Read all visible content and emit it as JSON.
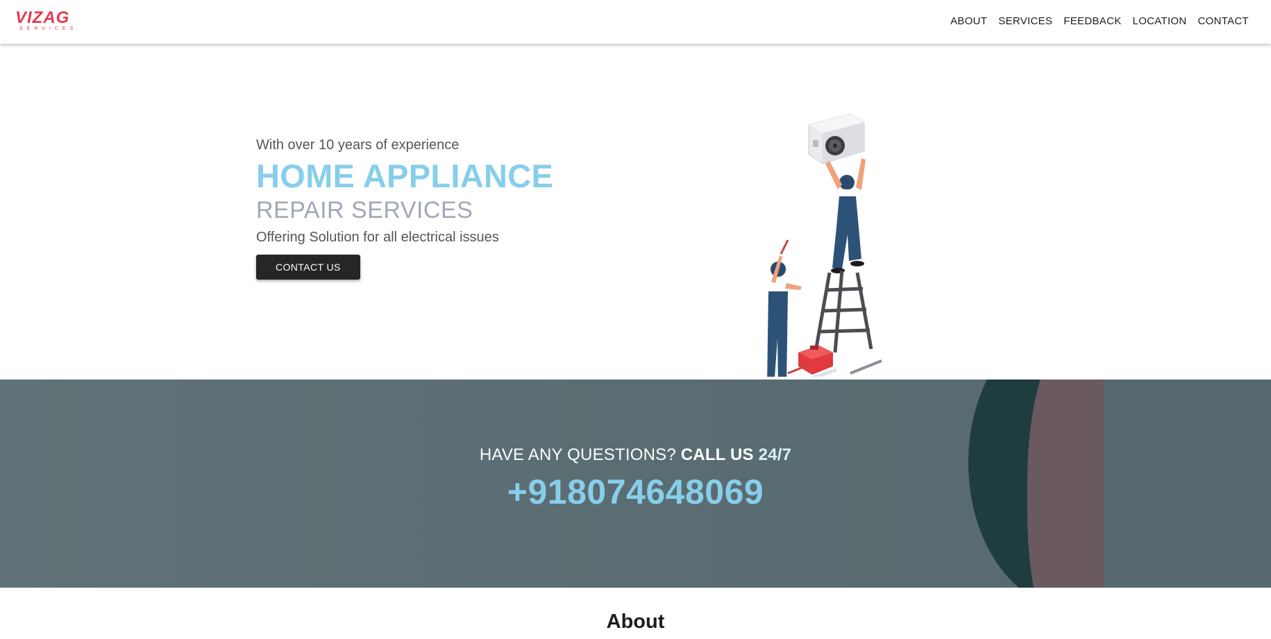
{
  "brand": {
    "logo_text": "VIZAG",
    "logo_sub": "SERVICES",
    "color": "#e03c4f"
  },
  "nav": {
    "items": [
      {
        "label": "ABOUT"
      },
      {
        "label": "SERVICES"
      },
      {
        "label": "FEEDBACK"
      },
      {
        "label": "LOCATION"
      },
      {
        "label": "CONTACT"
      }
    ]
  },
  "hero": {
    "experience": "With over 10 years of experience",
    "title_line1": "HOME APPLIANCE",
    "title_line2": "REPAIR SERVICES",
    "subtitle": "Offering Solution for all electrical issues",
    "cta_label": "CONTACT US",
    "accent_color": "#87ceeb",
    "illustration": "technicians-repairing-ac-illustration"
  },
  "callout": {
    "question": "HAVE ANY QUESTIONS?",
    "call_us": "CALL US",
    "hours": "24/7",
    "phone": "+918074648069"
  },
  "about": {
    "heading": "About"
  }
}
